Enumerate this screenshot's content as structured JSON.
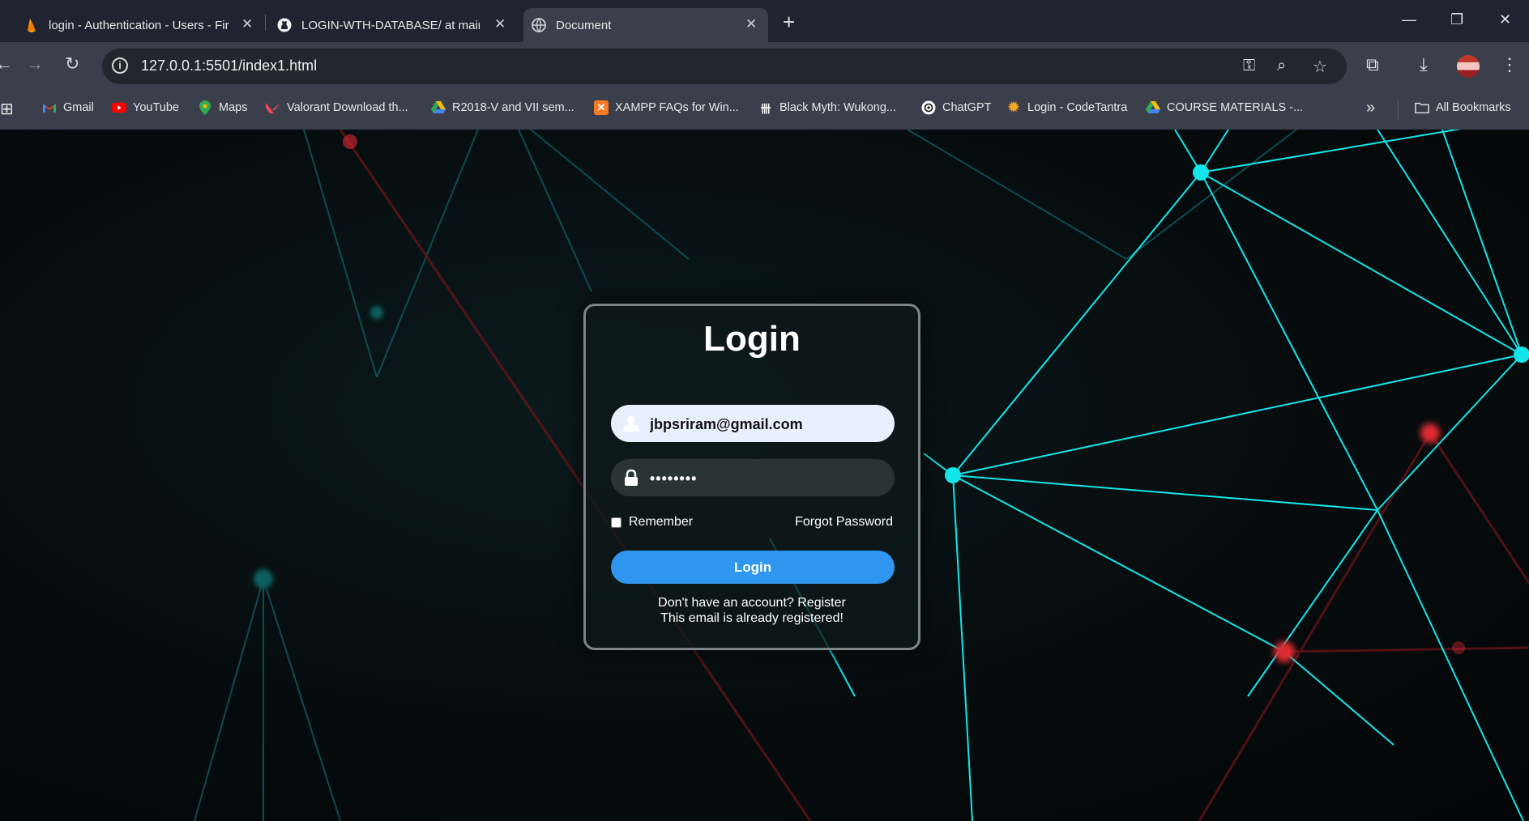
{
  "tabs": [
    {
      "title": "login - Authentication - Users - Fir",
      "icon": "firebase-icon"
    },
    {
      "title": "LOGIN-WTH-DATABASE/ at main ·",
      "icon": "github-icon"
    },
    {
      "title": "Document",
      "icon": "globe-icon",
      "active": true
    }
  ],
  "address_bar": {
    "url": "127.0.0.1:5501/index1.html"
  },
  "bookmarks": [
    {
      "label": "Gmail",
      "icon": "gmail-icon"
    },
    {
      "label": "YouTube",
      "icon": "youtube-icon"
    },
    {
      "label": "Maps",
      "icon": "maps-icon"
    },
    {
      "label": "Valorant Download th...",
      "icon": "valorant-icon"
    },
    {
      "label": "R2018-V and VII sem...",
      "icon": "google-drive-icon"
    },
    {
      "label": "XAMPP FAQs for Win...",
      "icon": "xampp-icon"
    },
    {
      "label": "Black Myth: Wukong...",
      "icon": "black-myth-icon"
    },
    {
      "label": "ChatGPT",
      "icon": "chatgpt-icon"
    },
    {
      "label": "Login - CodeTantra",
      "icon": "codetantra-icon"
    },
    {
      "label": "COURSE MATERIALS -...",
      "icon": "google-drive-icon"
    }
  ],
  "all_bookmarks_label": "All Bookmarks",
  "login_form": {
    "heading": "Login",
    "email_value": "jbpsriram@gmail.com",
    "password_value": "••••••••",
    "remember_label": "Remember",
    "forgot_label": "Forgot Password",
    "submit_label": "Login",
    "register_text": "Don't have an account? Register",
    "message": "This email is already registered!"
  },
  "colors": {
    "accent": "#2f97ef",
    "network_cyan": "#13e6ea",
    "network_red": "#e02a33",
    "tab_bar": "#1f2430",
    "toolbar": "#3a3f4b"
  }
}
